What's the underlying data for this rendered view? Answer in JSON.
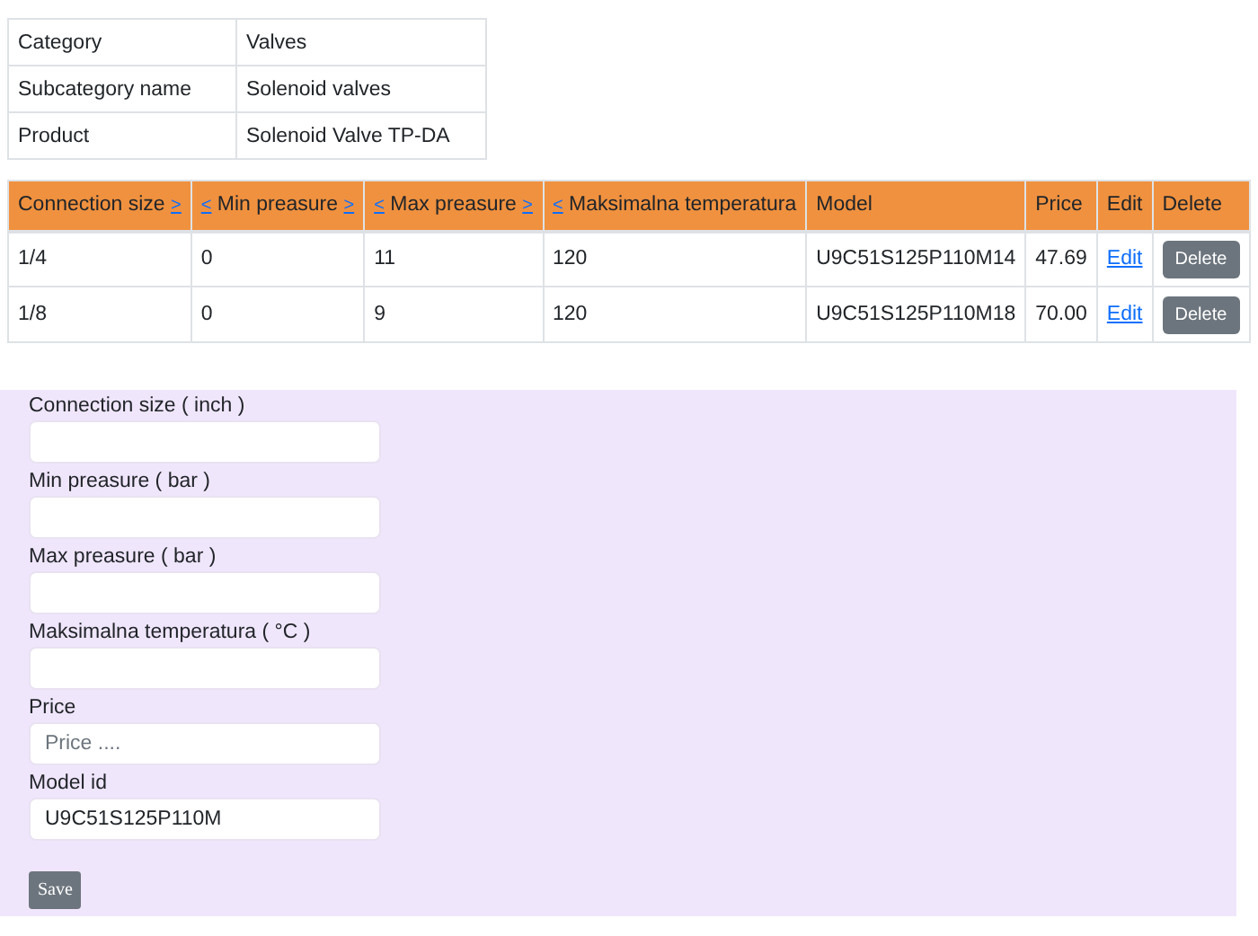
{
  "details": [
    {
      "label": "Category",
      "value": "Valves"
    },
    {
      "label": "Subcategory name",
      "value": "Solenoid valves"
    },
    {
      "label": "Product",
      "value": "Solenoid Valve TP-DA"
    }
  ],
  "table": {
    "columns": [
      {
        "label": "Connection size",
        "sort_up": ">"
      },
      {
        "label": "Min preasure",
        "sort_down": "<",
        "sort_up": ">"
      },
      {
        "label": "Max preasure",
        "sort_down": "<",
        "sort_up": ">"
      },
      {
        "label": "Maksimalna temperatura",
        "sort_down": "<"
      },
      {
        "label": "Model"
      },
      {
        "label": "Price"
      },
      {
        "label": "Edit"
      },
      {
        "label": "Delete"
      }
    ],
    "rows": [
      {
        "connection_size": "1/4",
        "min": "0",
        "max": "11",
        "temp": "120",
        "model": "U9C51S125P110M14",
        "price": "47.69",
        "edit": "Edit",
        "delete": "Delete"
      },
      {
        "connection_size": "1/8",
        "min": "0",
        "max": "9",
        "temp": "120",
        "model": "U9C51S125P110M18",
        "price": "70.00",
        "edit": "Edit",
        "delete": "Delete"
      }
    ]
  },
  "form": {
    "fields": [
      {
        "label": "Connection size ( inch )"
      },
      {
        "label": "Min preasure ( bar )"
      },
      {
        "label": "Max preasure ( bar )"
      },
      {
        "label": "Maksimalna temperatura ( °C )"
      },
      {
        "label": "Price",
        "placeholder": "Price ...."
      },
      {
        "label": "Model id",
        "value": "U9C51S125P110M"
      }
    ],
    "save": "Save"
  }
}
